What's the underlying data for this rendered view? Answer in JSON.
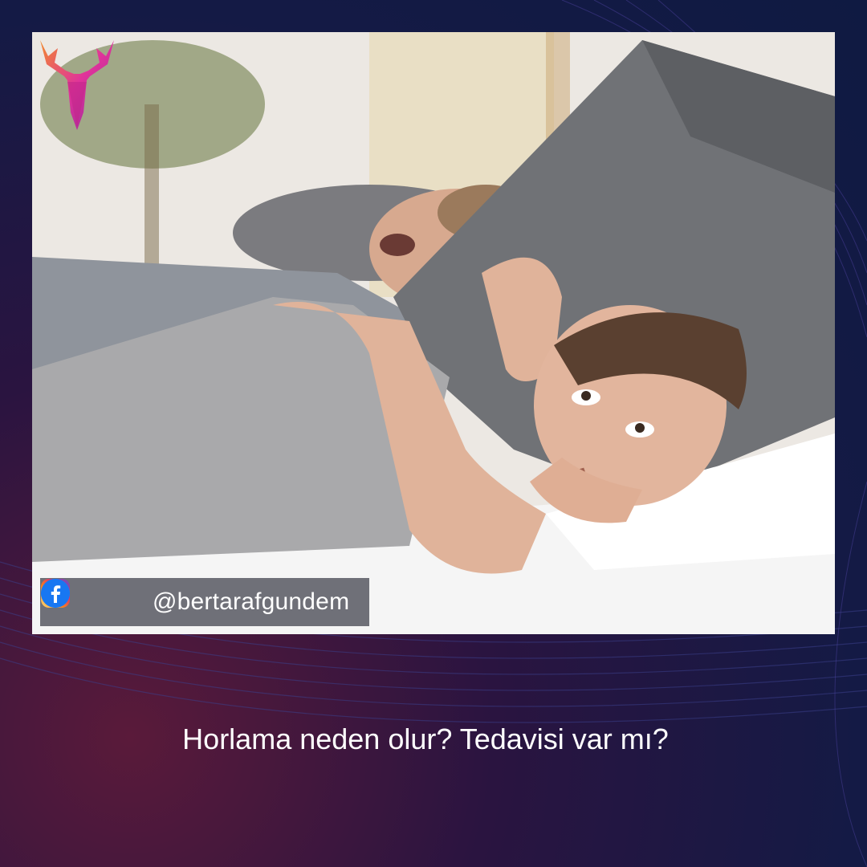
{
  "social": {
    "handle": "@bertarafgundem",
    "icons": [
      "instagram-icon",
      "twitter-icon",
      "facebook-icon"
    ]
  },
  "caption": "Horlama neden olur? Tedavisi var mı?",
  "colors": {
    "background_dark": "#141a45",
    "background_accent": "#5a1a3a",
    "bar": "#6f7078",
    "logo_pink": "#e0339b",
    "logo_orange": "#f28a2e"
  }
}
